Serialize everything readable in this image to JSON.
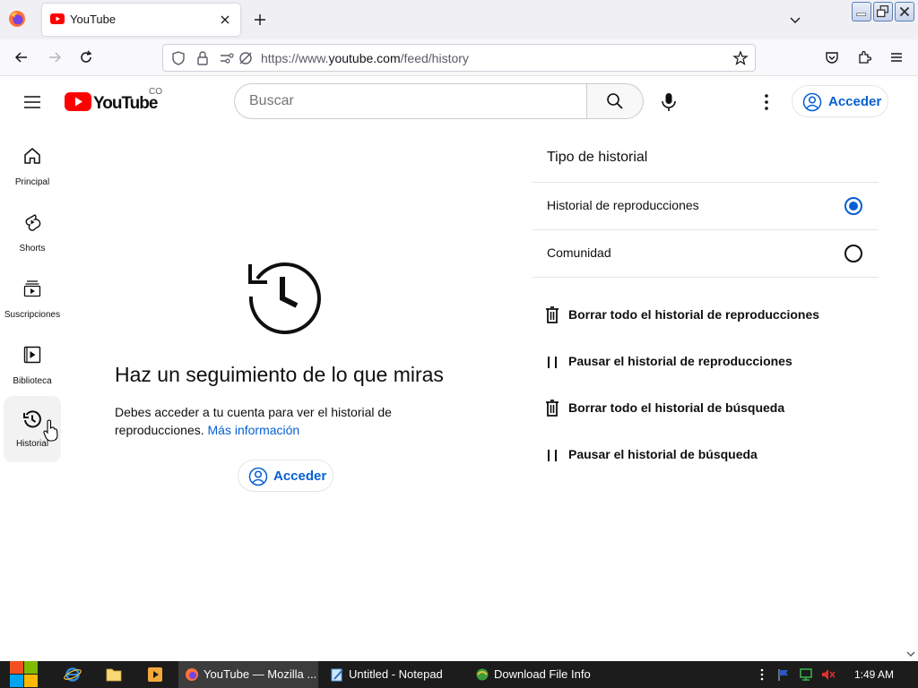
{
  "browser": {
    "tab_title": "YouTube",
    "url_prefix": "https://www.",
    "url_host": "youtube.com",
    "url_path": "/feed/history"
  },
  "masthead": {
    "country_code": "CO",
    "search_placeholder": "Buscar",
    "signin_label": "Acceder"
  },
  "guide": {
    "items": [
      {
        "label": "Principal",
        "icon": "home-icon"
      },
      {
        "label": "Shorts",
        "icon": "shorts-icon"
      },
      {
        "label": "Suscripciones",
        "icon": "subscriptions-icon"
      },
      {
        "label": "Biblioteca",
        "icon": "library-icon"
      },
      {
        "label": "Historial",
        "icon": "history-icon",
        "active": true
      }
    ]
  },
  "main": {
    "title": "Haz un seguimiento de lo que miras",
    "description": "Debes acceder a tu cuenta para ver el historial de reproducciones.",
    "more_info_link": "Más información",
    "signin_label": "Acceder"
  },
  "panel": {
    "title": "Tipo de historial",
    "options": [
      {
        "label": "Historial de reproducciones",
        "selected": true
      },
      {
        "label": "Comunidad",
        "selected": false
      }
    ],
    "actions": [
      {
        "label": "Borrar todo el historial de reproducciones",
        "icon": "trash-icon"
      },
      {
        "label": "Pausar el historial de reproducciones",
        "icon": "pause-icon"
      },
      {
        "label": "Borrar todo el historial de búsqueda",
        "icon": "trash-icon"
      },
      {
        "label": "Pausar el historial de búsqueda",
        "icon": "pause-icon"
      }
    ]
  },
  "taskbar": {
    "items": [
      {
        "label": "YouTube — Mozilla ...",
        "active": true
      },
      {
        "label": "Untitled - Notepad",
        "active": false
      },
      {
        "label": "Download File Info",
        "active": false
      }
    ],
    "clock": "1:49 AM"
  },
  "colors": {
    "brand_red": "#ff0000",
    "link_blue": "#065fd4",
    "taskbar_bg": "#1c1c1c"
  }
}
